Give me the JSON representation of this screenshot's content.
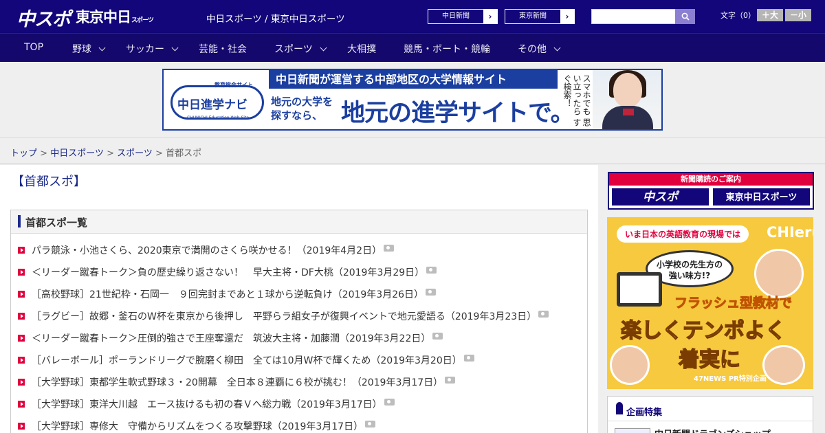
{
  "header": {
    "logo_main": "中スポ",
    "logo_sub": "東京中日",
    "logo_sub_small": "スポーツ",
    "site_title": "中日スポーツ / 東京中日スポーツ",
    "ext_links": [
      {
        "label": "中日新聞",
        "arrow": "›"
      },
      {
        "label": "東京新聞",
        "arrow": "›"
      }
    ],
    "search": {
      "placeholder": "",
      "value": ""
    },
    "font_size_label": "文字（0）",
    "font_larger": "＋大",
    "font_smaller": "－小"
  },
  "nav": {
    "items": [
      {
        "label": "TOP"
      },
      {
        "label": "野球"
      },
      {
        "label": "サッカー"
      },
      {
        "label": "芸能・社会"
      },
      {
        "label": "スポーツ"
      },
      {
        "label": "大相撲"
      },
      {
        "label": "競馬・ボート・競輪"
      },
      {
        "label": "その他"
      }
    ]
  },
  "banner": {
    "edu_label": "教育総合サイト",
    "logo_text": "中日進学ナビ",
    "web_label": "CHUNICHI Education Web Site",
    "strip": "中日新聞が運営する中部地区の大学情報サイト",
    "sub_line1": "地元の大学を",
    "sub_line2": "探すなら、",
    "headline": "地元の進学サイトで。",
    "vertical": "スマホでも 思い立ったら すぐ検索！"
  },
  "breadcrumb": {
    "items": [
      "トップ",
      "中日スポーツ",
      "スポーツ"
    ],
    "current": "首都スポ",
    "separator": ">"
  },
  "main": {
    "page_title": "【首都スポ】",
    "list_title": "首都スポ一覧",
    "articles": [
      "パラ競泳・小池さくら、2020東京で満開のさくら咲かせる！（2019年4月2日）",
      "＜リーダー蹴春トーク＞負の歴史繰り返さない！　早大主将・DF大桃（2019年3月29日）",
      "［高校野球］21世紀枠・石岡一　９回完封まであと１球から逆転負け（2019年3月26日）",
      "［ラグビー］故郷・釜石のW杯を東京から後押し　平野らラ組女子が復興イベントで地元愛語る（2019年3月23日）",
      "＜リーダー蹴春トーク＞圧倒的強さで王座奪還だ　筑波大主将・加藤潤（2019年3月22日）",
      "［バレーボール］ポーランドリーグで腕磨く柳田　全ては10月W杯で輝くため（2019年3月20日）",
      "［大学野球］東都学生軟式野球３・20開幕　全日本８連覇に６校が挑む！（2019年3月17日）",
      "［大学野球］東洋大川越　エース抜けるも初の春Ｖへ総力戦（2019年3月17日）",
      "［大学野球］専修大　守備からリズムをつくる攻撃野球（2019年3月17日）"
    ]
  },
  "sidebar": {
    "subscribe_header": "新聞購読のご案内",
    "subscribe_btn1": "中スポ",
    "subscribe_btn2": "東京中日スポーツ",
    "ad": {
      "pill": "いま日本の英語教育の現場では",
      "brand": "CHIeru",
      "bubble_l1": "小学校の先生方の",
      "bubble_l2": "強い味方!?",
      "flash": "フラッシュ型教材で",
      "big1": "楽しくテンポよく",
      "big2": "着実に",
      "pr": "47NEWS PR特別企画"
    },
    "feature_title": "企画特集",
    "feature_item": "中日新聞ドラゴンズショップ"
  }
}
